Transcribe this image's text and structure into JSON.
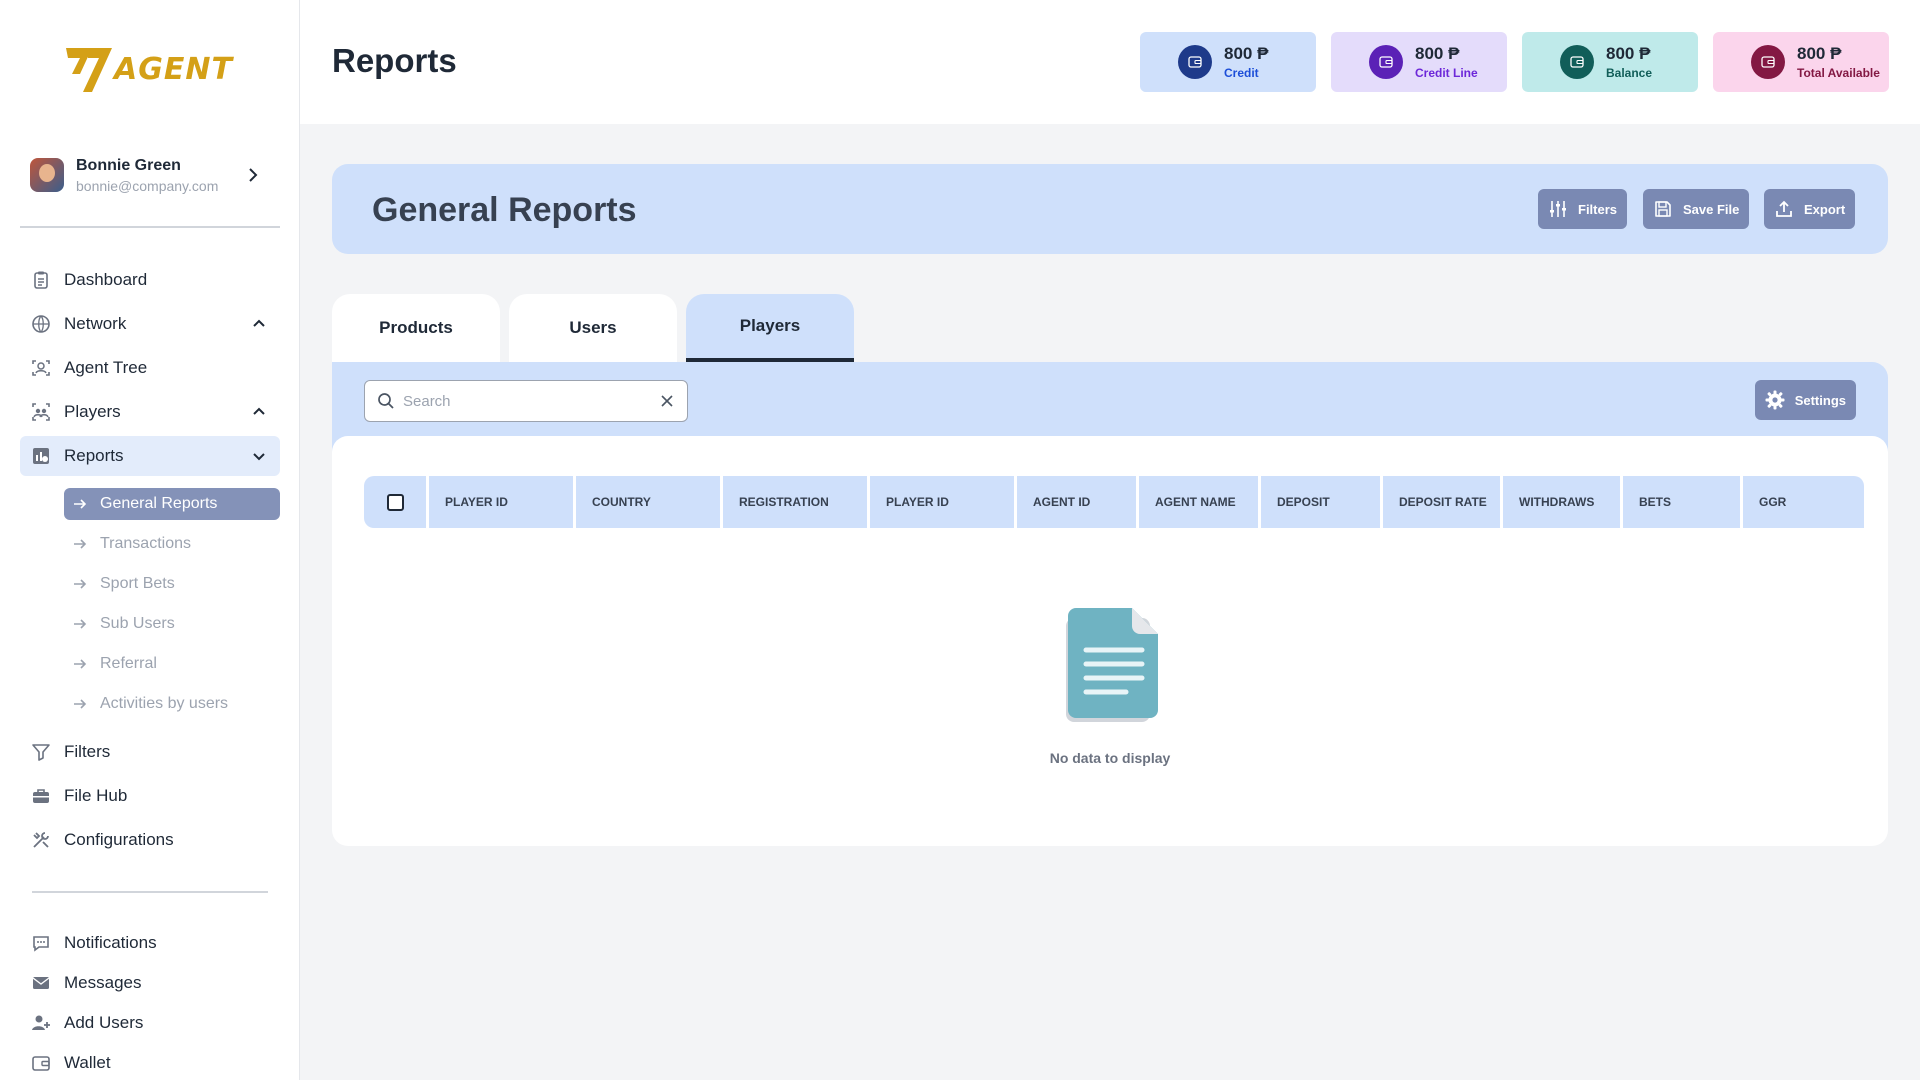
{
  "app": {
    "logo_text": "AGENT",
    "page_title": "Reports"
  },
  "user": {
    "name": "Bonnie Green",
    "email": "bonnie@company.com"
  },
  "sidebar": {
    "items": [
      {
        "label": "Dashboard",
        "icon": "clipboard-icon"
      },
      {
        "label": "Network",
        "icon": "globe-icon"
      },
      {
        "label": "Agent Tree",
        "icon": "scan-user-icon"
      },
      {
        "label": "Players",
        "icon": "players-icon"
      },
      {
        "label": "Reports",
        "icon": "reports-icon"
      }
    ],
    "reports_sub": [
      {
        "label": "General Reports"
      },
      {
        "label": "Transactions"
      },
      {
        "label": "Sport Bets"
      },
      {
        "label": "Sub Users"
      },
      {
        "label": "Referral"
      },
      {
        "label": "Activities by users"
      }
    ],
    "items_after": [
      {
        "label": "Filters",
        "icon": "filter-icon"
      },
      {
        "label": "File Hub",
        "icon": "briefcase-icon"
      },
      {
        "label": "Configurations",
        "icon": "tools-icon"
      }
    ],
    "bottom": [
      {
        "label": "Notifications",
        "icon": "chat-icon"
      },
      {
        "label": "Messages",
        "icon": "mail-icon"
      },
      {
        "label": "Add Users",
        "icon": "user-plus-icon"
      },
      {
        "label": "Wallet",
        "icon": "wallet-icon"
      }
    ]
  },
  "stats": [
    {
      "amount": "800 ₱",
      "label": "Credit",
      "bg": "#cfe0fb",
      "circle": "#1e3a8a",
      "label_color": "#1d4ed8"
    },
    {
      "amount": "800 ₱",
      "label": "Credit Line",
      "bg": "#e4dcfb",
      "circle": "#5b21b6",
      "label_color": "#6d28d9"
    },
    {
      "amount": "800 ₱",
      "label": "Balance",
      "bg": "#bfeaea",
      "circle": "#115e59",
      "label_color": "#115e59"
    },
    {
      "amount": "800 ₱",
      "label": "Total Available",
      "bg": "#fbd5ec",
      "circle": "#831843",
      "label_color": "#831843"
    }
  ],
  "banner": {
    "title": "General Reports",
    "filters_label": "Filters",
    "save_label": "Save File",
    "export_label": "Export"
  },
  "tabs": [
    {
      "label": "Products"
    },
    {
      "label": "Users"
    },
    {
      "label": "Players"
    }
  ],
  "search": {
    "placeholder": "Search",
    "value": ""
  },
  "settings_label": "Settings",
  "table": {
    "columns": [
      "PLAYER ID",
      "COUNTRY",
      "REGISTRATION",
      "PLAYER ID",
      "AGENT ID",
      "AGENT NAME",
      "DEPOSIT",
      "DEPOSIT RATE",
      "WITHDRAWS",
      "BETS",
      "GGR"
    ],
    "empty_text": "No data to display"
  }
}
